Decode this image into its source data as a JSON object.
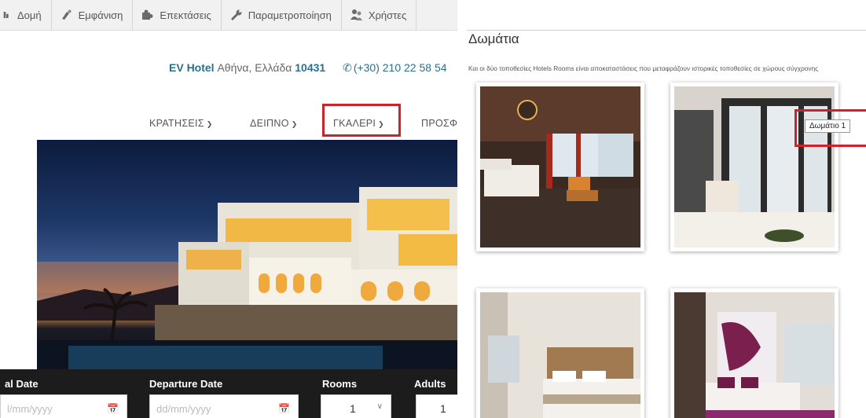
{
  "admin_bar": {
    "items": [
      {
        "label": "Δομή",
        "icon": "structure-icon"
      },
      {
        "label": "Εμφάνιση",
        "icon": "appearance-brush-icon"
      },
      {
        "label": "Επεκτάσεις",
        "icon": "extensions-puzzle-icon"
      },
      {
        "label": "Παραμετροποίηση",
        "icon": "wrench-icon"
      },
      {
        "label": "Χρήστες",
        "icon": "users-icon"
      }
    ]
  },
  "contact": {
    "brand": "EV Hotel",
    "address": "Αθήνα, Ελλάδα",
    "zip": "10431",
    "phone": "(+30) 210 22 58 54"
  },
  "nav": {
    "items": [
      {
        "label": "ΚΡΑΤΗΣΕΙΣ"
      },
      {
        "label": "ΔΕΙΠΝΟ"
      },
      {
        "label": "ΓΚΑΛΕΡΙ"
      },
      {
        "label": "ΠΡΟΣΦ"
      }
    ],
    "highlighted": "ΓΚΑΛΕΡΙ"
  },
  "booking": {
    "arrival_label": "al Date",
    "arrival_placeholder": "l/mm/yyyy",
    "departure_label": "Departure Date",
    "departure_placeholder": "dd/mm/yyyy",
    "rooms_label": "Rooms",
    "rooms_value": "1",
    "adults_label": "Adults",
    "adults_value": "1"
  },
  "gallery": {
    "title": "Δωμάτια",
    "description": "Και οι δύο τοποθεσίες Hotels Rooms είναι αποκαταστάσεις που μεταφράζουν ιστορικές τοποθεσίες σε χώρους σύγχρονης",
    "tooltip": "Δωμάτιο 1",
    "thumbnails": [
      {
        "name": "room-thumbnail-1"
      },
      {
        "name": "room-thumbnail-2"
      },
      {
        "name": "room-thumbnail-3"
      },
      {
        "name": "room-thumbnail-4"
      }
    ]
  },
  "colors": {
    "highlight": "#d0202a",
    "brand": "#2c6f8c",
    "admin_bar": "#f1f1f1"
  }
}
